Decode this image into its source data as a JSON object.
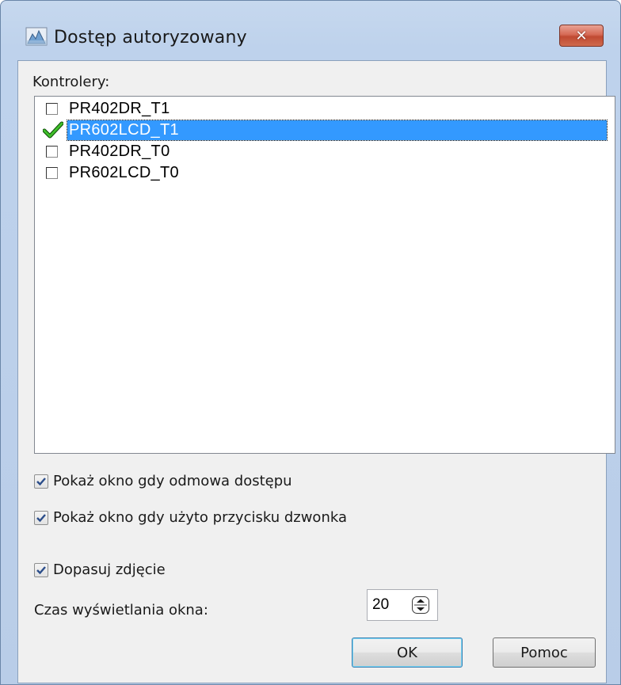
{
  "window": {
    "title": "Dostęp autoryzowany",
    "close_symbol": "✕",
    "icon": "app-icon"
  },
  "controllers": {
    "label": "Kontrolery:",
    "items": [
      {
        "label": "PR402DR_T1",
        "checked": false,
        "selected": false
      },
      {
        "label": "PR602LCD_T1",
        "checked": true,
        "selected": true
      },
      {
        "label": "PR402DR_T0",
        "checked": false,
        "selected": false
      },
      {
        "label": "PR602LCD_T0",
        "checked": false,
        "selected": false
      }
    ]
  },
  "options": {
    "show_on_denied": {
      "label": "Pokaż okno gdy odmowa dostępu",
      "checked": true
    },
    "show_on_bell": {
      "label": "Pokaż okno gdy użyto przycisku dzwonka",
      "checked": true
    },
    "fit_photo": {
      "label": "Dopasuj zdjęcie",
      "checked": true
    }
  },
  "display_time": {
    "label": "Czas wyświetlania okna:",
    "value": "20"
  },
  "buttons": {
    "ok": "OK",
    "help": "Pomoc"
  },
  "colors": {
    "selection": "#3399ff",
    "close_button": "#c04a32",
    "checkmark_green": "#2a9a1a"
  }
}
